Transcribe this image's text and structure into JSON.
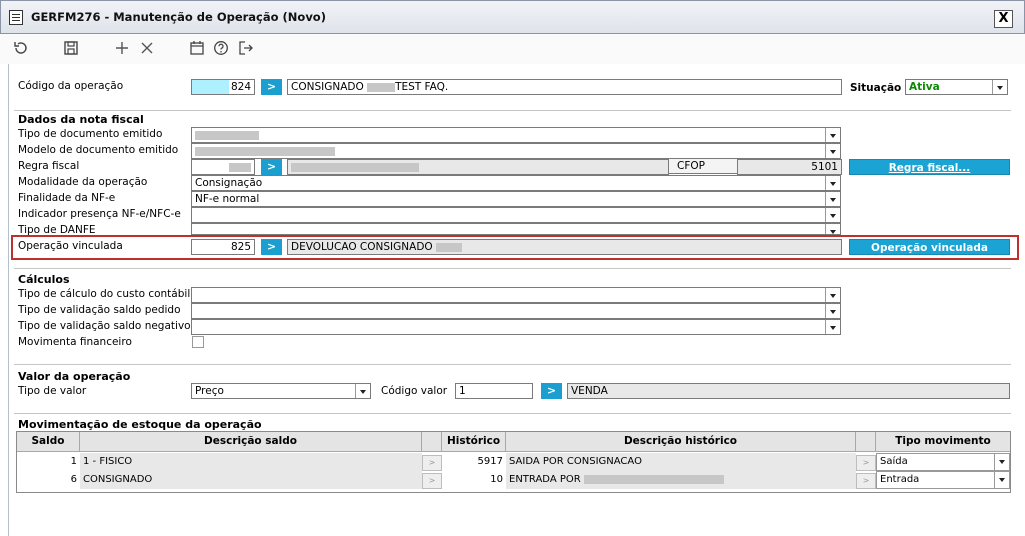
{
  "window": {
    "title": "GERFM276 - Manutenção de Operação (Novo)",
    "close": "X"
  },
  "toolbar": {
    "icons": [
      "refresh-icon",
      "save-icon",
      "add-icon",
      "delete-icon",
      "calendar-icon",
      "help-icon",
      "exit-icon"
    ]
  },
  "operacao": {
    "label": "Código da operação",
    "code": "824",
    "desc_prefix": "CONSIGNADO",
    "desc_suffix": "TEST FAQ.",
    "situacao_label": "Situação",
    "situacao_value": "Ativa"
  },
  "nota": {
    "section": "Dados da nota fiscal",
    "tipo_doc_label": "Tipo de documento emitido",
    "modelo_doc_label": "Modelo de documento emitido",
    "regra_label": "Regra fiscal",
    "cfop_label": "CFOP",
    "cfop_value": "5101",
    "regra_button": "Regra fiscal...",
    "modalidade_label": "Modalidade da operação",
    "modalidade_value": "Consignação",
    "finalidade_label": "Finalidade da NF-e",
    "finalidade_value": "NF-e normal",
    "indicador_label": "Indicador presença NF-e/NFC-e",
    "danfe_label": "Tipo de DANFE",
    "vinculada_label": "Operação vinculada",
    "vinculada_code": "825",
    "vinculada_desc": "DEVOLUCAO CONSIGNADO",
    "vinculada_button": "Operação vinculada"
  },
  "calculos": {
    "section": "Cálculos",
    "custo_label": "Tipo de cálculo do custo contábil",
    "saldo_pedido_label": "Tipo de validação saldo pedido",
    "saldo_negativo_label": "Tipo de validação saldo negativo",
    "financeiro_label": "Movimenta financeiro"
  },
  "valor": {
    "section": "Valor da operação",
    "tipo_label": "Tipo de valor",
    "tipo_value": "Preço",
    "codigo_label": "Código valor",
    "codigo_value": "1",
    "codigo_desc": "VENDA"
  },
  "estoque": {
    "section": "Movimentação de estoque da operação",
    "headers": {
      "saldo": "Saldo",
      "desc_saldo": "Descrição saldo",
      "historico": "Histórico",
      "desc_historico": "Descrição histórico",
      "tipo": "Tipo movimento"
    },
    "rows": [
      {
        "saldo": "1",
        "desc_saldo": "1 - FISICO",
        "historico": "5917",
        "desc_historico": "SAIDA POR CONSIGNACAO",
        "tipo": "Saída"
      },
      {
        "saldo": "6",
        "desc_saldo": "CONSIGNADO",
        "historico": "10",
        "desc_historico": "ENTRADA POR",
        "tipo": "Entrada"
      }
    ],
    "row_button": ">"
  },
  "colors": {
    "accent": "#1aa3d3",
    "highlight_border": "#c0302a",
    "active_text": "#0a8a00"
  }
}
